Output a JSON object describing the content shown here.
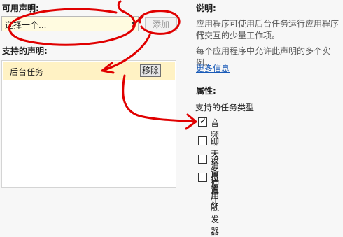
{
  "left": {
    "available_label": "可用声明:",
    "select_value": "选择一个...",
    "add_button": "添加",
    "supported_label": "支持的声明:",
    "declarations": [
      {
        "name": "后台任务",
        "remove_label": "移除"
      }
    ]
  },
  "right": {
    "description_label": "说明:",
    "description_line1": "应用程序可使用后台任务运行应用程序代",
    "description_line2": "行交互的少量工作项。",
    "description_line3": "每个应用程序中允许此声明的多个实例。",
    "more_info_link": "更多信息",
    "properties_label": "属性:",
    "task_types_label": "支持的任务类型",
    "task_types": [
      {
        "label": "音频",
        "checked": true
      },
      {
        "label": "聊天消息通知",
        "checked": false
      },
      {
        "label": "设备使用触发器",
        "checked": false
      },
      {
        "label": "位置",
        "checked": false
      }
    ]
  },
  "annotation_color": "#e00000"
}
